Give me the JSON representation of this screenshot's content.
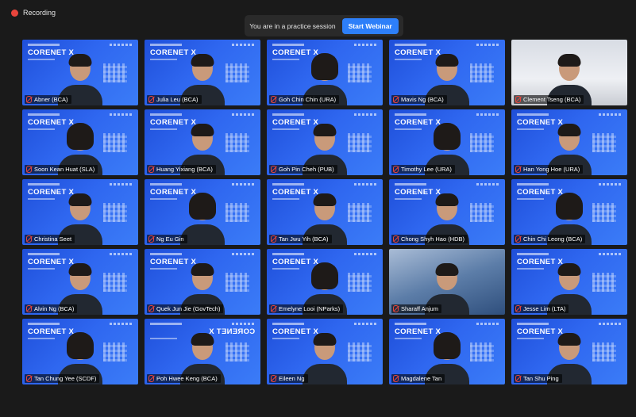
{
  "recording": {
    "label": "Recording"
  },
  "banner": {
    "message": "You are in a practice session",
    "button": "Start Webinar"
  },
  "colors": {
    "accent": "#2d7ff9",
    "recording": "#e8453c",
    "background": "#1a1a1a"
  },
  "background_text": "CORENET X",
  "participants": [
    {
      "name": "Abner (BCA)",
      "bg": "webinar"
    },
    {
      "name": "Julia Leu (BCA)",
      "bg": "webinar"
    },
    {
      "name": "Goh Chin Chin (URA)",
      "bg": "webinar"
    },
    {
      "name": "Mavis Ng (BCA)",
      "bg": "webinar"
    },
    {
      "name": "Clement Tseng (BCA)",
      "bg": "plain"
    },
    {
      "name": "Soon Kean Huat (SLA)",
      "bg": "webinar"
    },
    {
      "name": "Huang Yixiang (BCA)",
      "bg": "webinar"
    },
    {
      "name": "Goh Pin Cheh (PUB)",
      "bg": "webinar"
    },
    {
      "name": "Timothy Lee (URA)",
      "bg": "webinar"
    },
    {
      "name": "Han Yong Hoe (URA)",
      "bg": "webinar"
    },
    {
      "name": "Christina Seet",
      "bg": "webinar"
    },
    {
      "name": "Ng Eu Gin",
      "bg": "webinar"
    },
    {
      "name": "Tan Jwu Yih (BCA)",
      "bg": "webinar"
    },
    {
      "name": "Chong Shyh Hao (HDB)",
      "bg": "webinar"
    },
    {
      "name": "Chin Chi Leong (BCA)",
      "bg": "webinar"
    },
    {
      "name": "Alvin Ng (BCA)",
      "bg": "webinar"
    },
    {
      "name": "Quek Jun Jie (GovTech)",
      "bg": "webinar"
    },
    {
      "name": "Emelyne Looi (NParks)",
      "bg": "webinar"
    },
    {
      "name": "Sharaff Anjum",
      "bg": "office"
    },
    {
      "name": "Jesse Lim (LTA)",
      "bg": "webinar"
    },
    {
      "name": "Tan Chung Yee (SCDF)",
      "bg": "webinar"
    },
    {
      "name": "Poh Hwee Keng (BCA)",
      "bg": "webinar-mirror"
    },
    {
      "name": "Eileen Ng",
      "bg": "webinar"
    },
    {
      "name": "Magdalene Tan",
      "bg": "webinar"
    },
    {
      "name": "Tan Shu Ping",
      "bg": "webinar"
    }
  ]
}
